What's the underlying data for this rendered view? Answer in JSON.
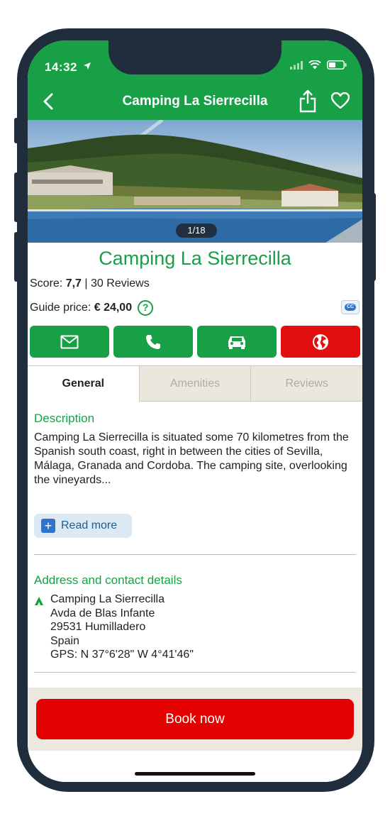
{
  "status": {
    "time": "14:32"
  },
  "nav": {
    "title": "Camping La Sierrecilla"
  },
  "gallery": {
    "counter": "1/18"
  },
  "site": {
    "name": "Camping La Sierrecilla",
    "score_label": "Score:",
    "score_value": "7,7",
    "reviews": "30 Reviews",
    "price_label": "Guide price:",
    "price_value": "€ 24,00",
    "help_symbol": "?",
    "cc_badge": "CC"
  },
  "actions": [
    {
      "icon": "mail-icon"
    },
    {
      "icon": "phone-icon"
    },
    {
      "icon": "car-icon"
    },
    {
      "icon": "globe-icon"
    }
  ],
  "tabs": [
    {
      "label": "General"
    },
    {
      "label": "Amenities"
    },
    {
      "label": "Reviews"
    }
  ],
  "description": {
    "title": "Description",
    "text": "Camping La Sierrecilla is situated some 70 kilometres from the Spanish south coast, right in between the cities of Sevilla, Málaga, Granada and Cordoba. The camping site, overlooking the vineyards...",
    "read_more": "Read more",
    "read_more_symbol": "+"
  },
  "address": {
    "title": "Address and contact details",
    "name": "Camping La Sierrecilla",
    "street": "Avda de Blas Infante",
    "city": "29531 Humilladero",
    "country": "Spain",
    "gps": "GPS: N 37°6'28\" W 4°41'46\""
  },
  "booking": {
    "button": "Book now"
  },
  "colors": {
    "green": "#18a047",
    "red": "#e30f0f",
    "book_red": "#e30000"
  }
}
